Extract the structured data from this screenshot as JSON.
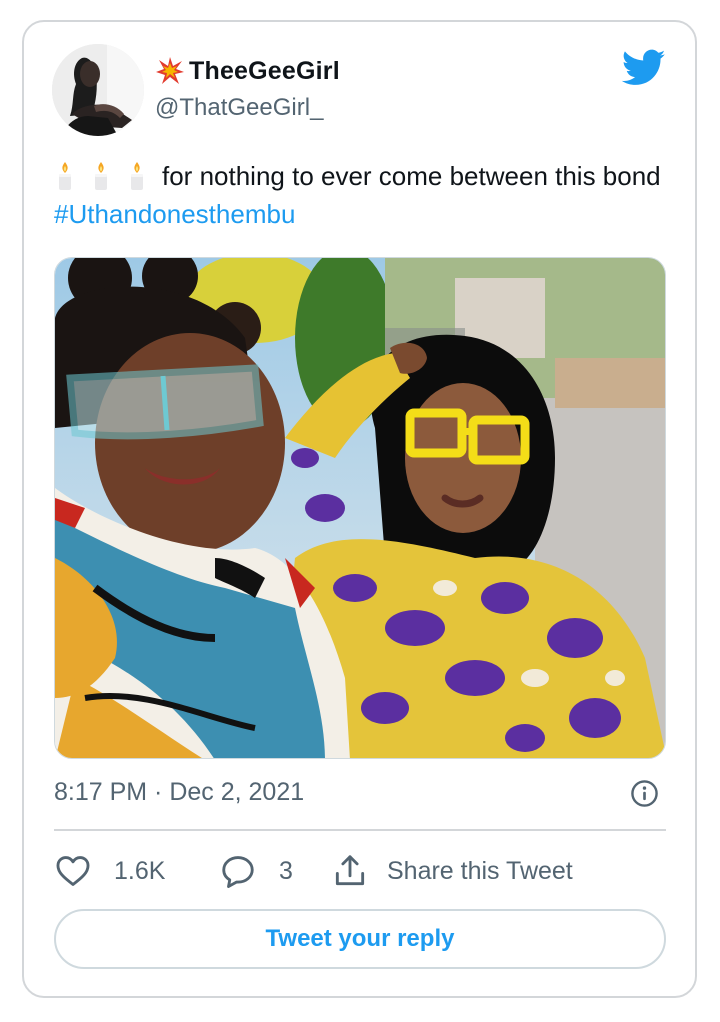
{
  "author": {
    "display_name": "TheeGeeGirl",
    "handle": "@ThatGeeGirl_",
    "name_badge_icon": "explosion-emoji-icon"
  },
  "tweet": {
    "candles": [
      "candle-emoji",
      "candle-emoji",
      "candle-emoji"
    ],
    "text": "for nothing to ever come between this bond",
    "hashtag": "#Uthandonesthembu",
    "timestamp": "8:17 PM · Dec 2, 2021"
  },
  "actions": {
    "likes": "1.6K",
    "replies": "3",
    "share_label": "Share this Tweet"
  },
  "reply_button_label": "Tweet your reply",
  "colors": {
    "twitter_blue": "#1d9bf0",
    "secondary_text": "#536471",
    "border": "#d3d6d9"
  }
}
